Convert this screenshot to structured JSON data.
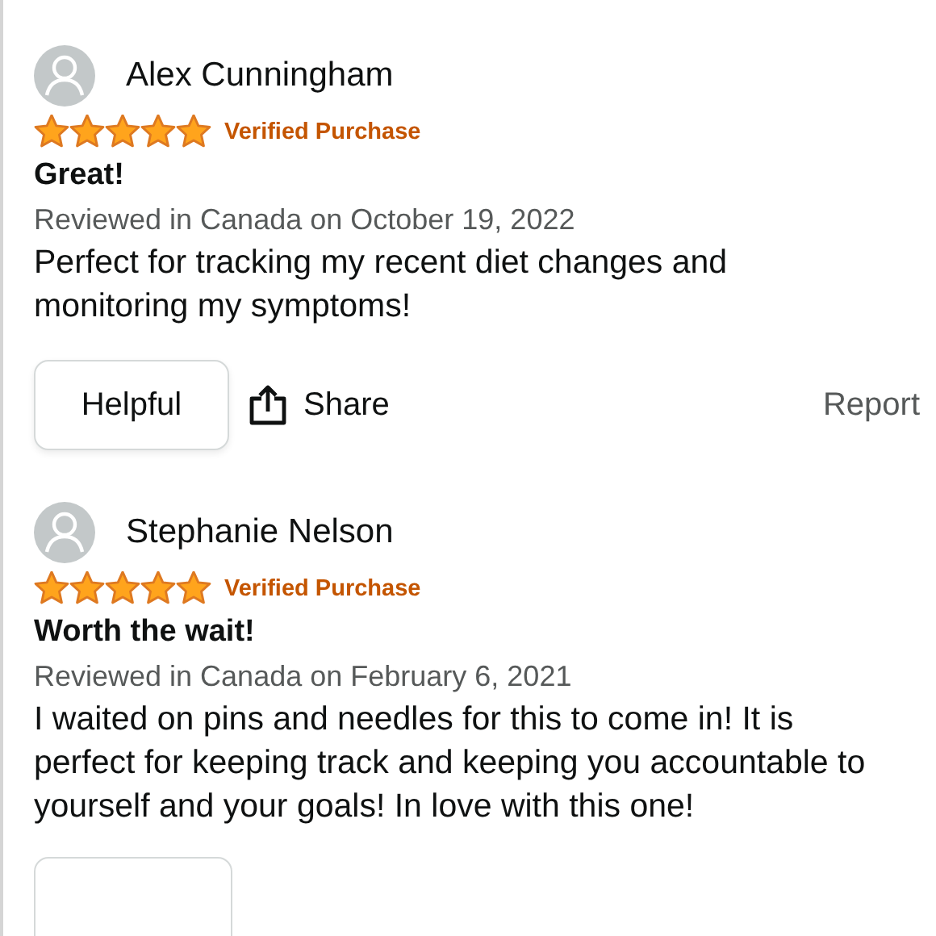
{
  "reviews": [
    {
      "reviewer": "Alex Cunningham",
      "stars": 5,
      "badge": "Verified Purchase",
      "title": "Great!",
      "meta": "Reviewed in Canada on October 19, 2022",
      "body": "Perfect for tracking my recent diet changes and monitoring my symptoms!",
      "actions": {
        "helpful": "Helpful",
        "share": "Share",
        "report": "Report"
      }
    },
    {
      "reviewer": "Stephanie Nelson",
      "stars": 5,
      "badge": "Verified Purchase",
      "title": "Worth the wait!",
      "meta": "Reviewed in Canada on February 6, 2021",
      "body": "I waited on pins and needles for this to come in! It is perfect for keeping track and keeping you accountable to yourself and your goals! In love with this one!"
    }
  ]
}
